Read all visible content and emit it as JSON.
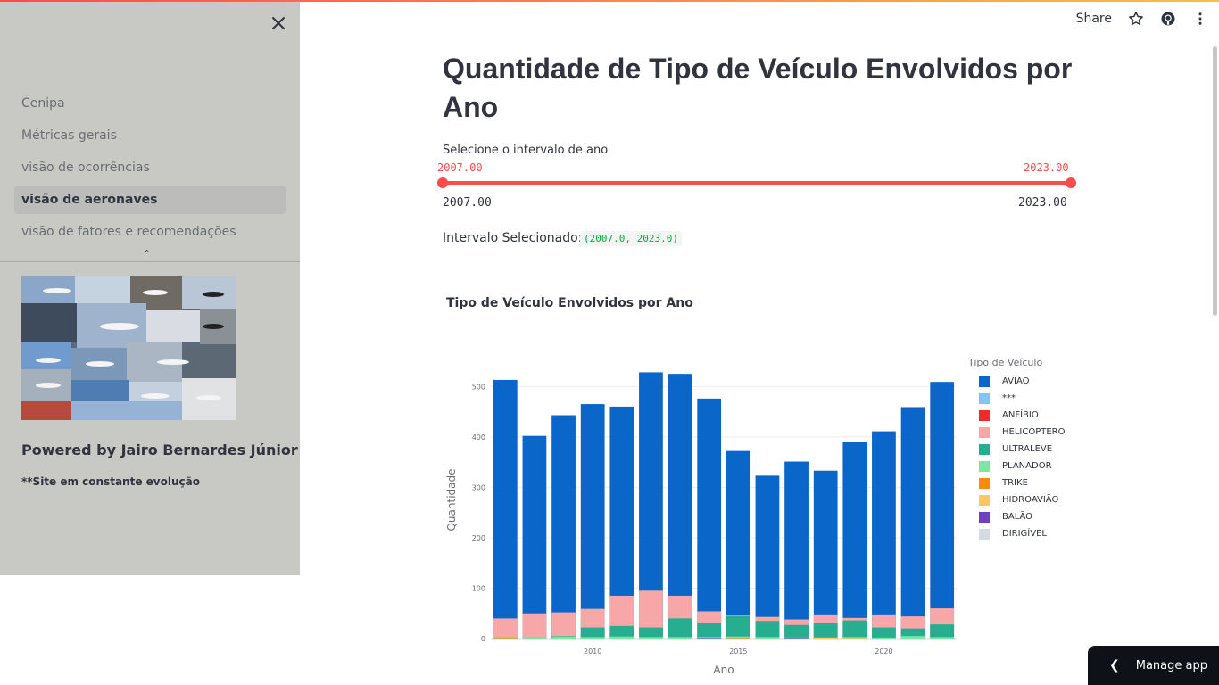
{
  "sidebar": {
    "items": [
      {
        "label": "Cenipa"
      },
      {
        "label": "Métricas gerais"
      },
      {
        "label": "visão de ocorrências"
      },
      {
        "label": "visão de aeronaves"
      },
      {
        "label": "visão de fatores e recomendações"
      }
    ],
    "powered_by": "Powered by Jairo Bernardes Júnior",
    "note": "**Site em constante evolução"
  },
  "header": {
    "share_label": "Share"
  },
  "main": {
    "title": "Quantidade de Tipo de Veículo Envolvidos por Ano",
    "slider": {
      "label": "Selecione o intervalo de ano",
      "low_value": "2007.00",
      "high_value": "2023.00",
      "min_label": "2007.00",
      "max_label": "2023.00"
    },
    "interval_label": "Intervalo Selecionado:",
    "interval_value": "(2007.0, 2023.0)",
    "chart_title": "Tipo de Veículo Envolvidos por Ano"
  },
  "manage_app_label": "Manage app",
  "colors": {
    "accent": "#ff4b4b",
    "sidebar_bg": "#c8c9c4"
  },
  "chart_data": {
    "type": "bar",
    "xlabel": "Ano",
    "ylabel": "Quantidade",
    "legend_title": "Tipo de Veículo",
    "legend_position": "right",
    "x": [
      2007,
      2008,
      2009,
      2010,
      2011,
      2012,
      2013,
      2014,
      2015,
      2016,
      2017,
      2018,
      2019,
      2020,
      2021,
      2022
    ],
    "x_ticks": [
      2010,
      2015,
      2020
    ],
    "y_ticks": [
      0,
      100,
      200,
      300,
      400,
      500
    ],
    "ylim": [
      0,
      550
    ],
    "grid": true,
    "series": [
      {
        "name": "AVIÃO",
        "color": "#0a66c8",
        "values": [
          513,
          402,
          443,
          465,
          460,
          528,
          525,
          476,
          372,
          323,
          351,
          333,
          390,
          411,
          459,
          509
        ]
      },
      {
        "name": "***",
        "color": "#7fc7f6",
        "values": [
          0,
          0,
          0,
          0,
          0,
          0,
          0,
          0,
          0,
          0,
          0,
          0,
          0,
          0,
          0,
          0
        ]
      },
      {
        "name": "ANFÍBIO",
        "color": "#ef2a2a",
        "values": [
          0,
          0,
          0,
          0,
          0,
          0,
          0,
          0,
          0,
          0,
          0,
          0,
          0,
          0,
          0,
          0
        ]
      },
      {
        "name": "HELICÓPTERO",
        "color": "#f7a7a7",
        "values": [
          40,
          50,
          52,
          59,
          85,
          95,
          85,
          54,
          47,
          43,
          38,
          48,
          41,
          48,
          44,
          60
        ]
      },
      {
        "name": "ULTRALEVE",
        "color": "#27ad8f",
        "values": [
          2,
          3,
          5,
          22,
          25,
          22,
          40,
          32,
          45,
          35,
          27,
          31,
          36,
          22,
          20,
          28
        ]
      },
      {
        "name": "PLANADOR",
        "color": "#7ee6a4",
        "values": [
          2,
          3,
          4,
          3,
          4,
          3,
          3,
          3,
          4,
          3,
          2,
          2,
          3,
          2,
          5,
          3
        ]
      },
      {
        "name": "TRIKE",
        "color": "#f88a0c",
        "values": [
          1,
          0,
          0,
          0,
          0,
          0,
          0,
          0,
          1,
          0,
          0,
          1,
          1,
          0,
          0,
          0
        ]
      },
      {
        "name": "HIDROAVIÃO",
        "color": "#fac85f",
        "values": [
          0,
          0,
          0,
          0,
          0,
          0,
          0,
          0,
          0,
          0,
          0,
          2,
          1,
          0,
          0,
          0
        ]
      },
      {
        "name": "BALÃO",
        "color": "#6e41bd",
        "values": [
          0,
          0,
          0,
          0,
          0,
          0,
          0,
          1,
          0,
          0,
          1,
          0,
          0,
          0,
          0,
          0
        ]
      },
      {
        "name": "DIRIGÍVEL",
        "color": "#d5dae5",
        "values": [
          0,
          0,
          0,
          0,
          0,
          0,
          0,
          0,
          0,
          0,
          0,
          0,
          0,
          0,
          0,
          0
        ]
      }
    ]
  }
}
